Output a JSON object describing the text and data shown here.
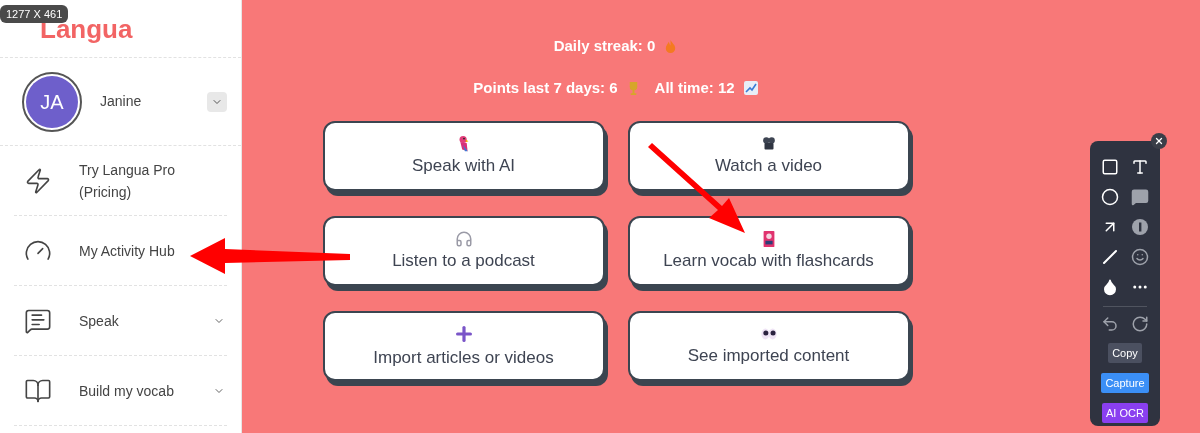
{
  "size_badge": "1277 X 461",
  "logo": "Langua",
  "profile": {
    "initials": "JA",
    "name": "Janine"
  },
  "nav": [
    {
      "label": "Try Langua Pro (Pricing)",
      "kind": "bolt",
      "expandable": false
    },
    {
      "label": "My Activity Hub",
      "kind": "gauge",
      "expandable": false
    },
    {
      "label": "Speak",
      "kind": "chat",
      "expandable": true
    },
    {
      "label": "Build my vocab",
      "kind": "book",
      "expandable": true
    }
  ],
  "stats": {
    "streak": "Daily streak: 0",
    "points": "Points last 7 days: 6",
    "all_time": "All time: 12"
  },
  "cards": [
    {
      "label": "Speak with AI",
      "kind": "parrot"
    },
    {
      "label": "Watch a video",
      "kind": "camera"
    },
    {
      "label": "Listen to a podcast",
      "kind": "headphones"
    },
    {
      "label": "Learn vocab with flashcards",
      "kind": "flashcard"
    },
    {
      "label": "Import articles or videos",
      "kind": "plus"
    },
    {
      "label": "See imported content",
      "kind": "eyes"
    }
  ],
  "toolbar": {
    "tools": [
      {
        "kind": "rectangle"
      },
      {
        "kind": "text"
      },
      {
        "kind": "ellipse"
      },
      {
        "kind": "callout"
      },
      {
        "kind": "arrow"
      },
      {
        "kind": "step"
      },
      {
        "kind": "pen"
      },
      {
        "kind": "emoji"
      },
      {
        "kind": "blur"
      },
      {
        "kind": "more"
      }
    ],
    "buttons": [
      {
        "label": "Copy",
        "color": "#4b5060"
      },
      {
        "label": "Capture",
        "color": "#3b8ff6"
      },
      {
        "label": "AI OCR",
        "color": "#8a3ff0"
      }
    ]
  }
}
